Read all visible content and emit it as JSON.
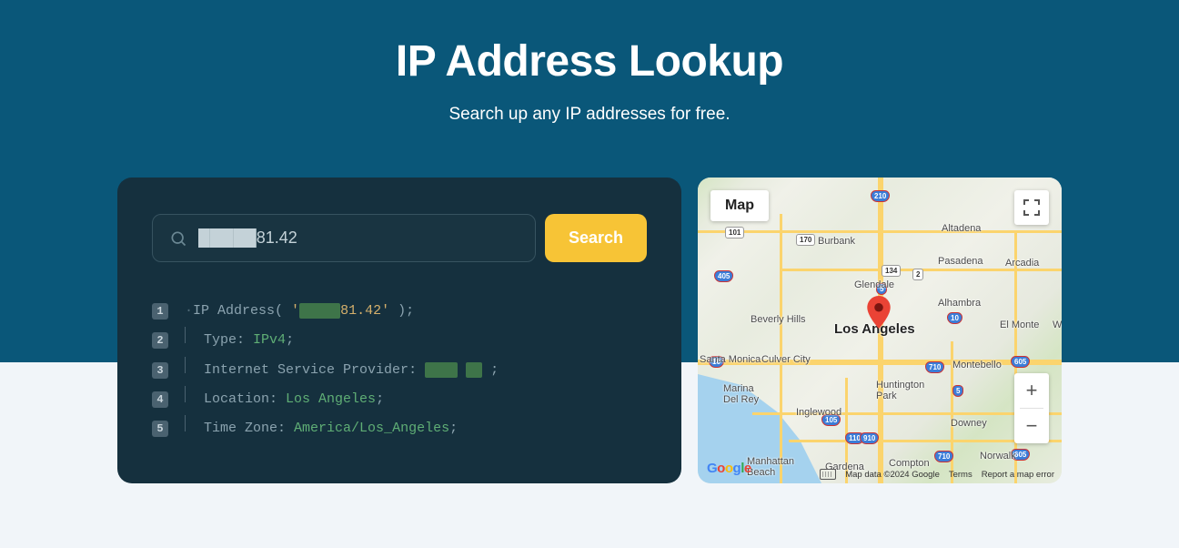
{
  "hero": {
    "title": "IP Address Lookup",
    "subtitle": "Search up any IP addresses for free."
  },
  "search": {
    "value": "█████81.42",
    "button": "Search"
  },
  "code": {
    "lines": [
      {
        "num": "1",
        "prefix_label": "IP Address",
        "ip_left": "█████",
        "ip_right": "81.42"
      },
      {
        "num": "2",
        "label": "Type",
        "value": "IPv4"
      },
      {
        "num": "3",
        "label": "Internet Service Provider",
        "redacted": true
      },
      {
        "num": "4",
        "label": "Location",
        "value": "Los Angeles"
      },
      {
        "num": "5",
        "label": "Time Zone",
        "value": "America/Los_Angeles"
      }
    ]
  },
  "map": {
    "type_button": "Map",
    "center_label": "Los Angeles",
    "cities": {
      "burbank": "Burbank",
      "altadena": "Altadena",
      "pasadena": "Pasadena",
      "glendale": "Glendale",
      "arcadia": "Arcadia",
      "beverly": "Beverly Hills",
      "alhambra": "Alhambra",
      "elmonte": "El Monte",
      "santamonica": "Santa Monica",
      "culver": "Culver City",
      "montebello": "Montebello",
      "marina": "Marina\nDel Rey",
      "huntington": "Huntington\nPark",
      "inglewood": "Inglewood",
      "downey": "Downey",
      "compton": "Compton",
      "norwalk": "Norwalk",
      "gardena": "Gardena",
      "manhattan": "Manhattan\nBeach",
      "west": "We"
    },
    "shields": {
      "i210": "210",
      "r101a": "101",
      "r170": "170",
      "r134": "134",
      "i405": "405",
      "i5a": "5",
      "i5b": "5",
      "r2": "2",
      "i10a": "10",
      "i10b": "10",
      "i710a": "710",
      "i710b": "710",
      "i605a": "605",
      "i605b": "605",
      "i110a": "110",
      "i110b": "110",
      "i105": "105",
      "i910": "910"
    },
    "footer": {
      "attribution": "Map data ©2024 Google",
      "terms": "Terms",
      "report": "Report a map error"
    },
    "logo": "Google"
  }
}
